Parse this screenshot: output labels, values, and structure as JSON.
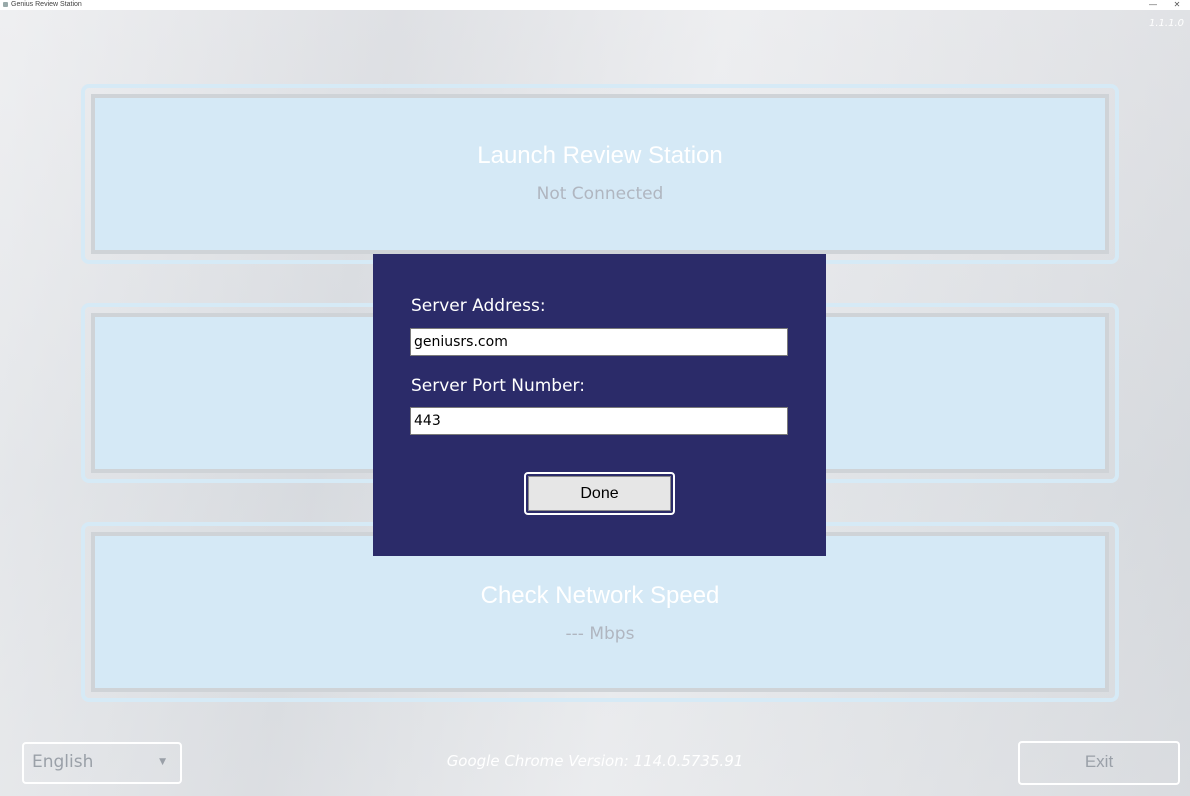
{
  "window": {
    "title": "Genius Review Station",
    "minimize_glyph": "—",
    "close_glyph": "✕"
  },
  "version": "1.1.1.0",
  "panels": [
    {
      "title": "Launch Review Station",
      "status": "Not Connected"
    },
    {
      "title": "",
      "status": ""
    },
    {
      "title": "Check Network Speed",
      "status": "--- Mbps"
    }
  ],
  "dialog": {
    "server_address_label": "Server Address:",
    "server_address_value": "geniusrs.com",
    "server_port_label": "Server Port Number:",
    "server_port_value": "443",
    "done_label": "Done"
  },
  "footer": {
    "language": "English",
    "chrome_version": "Google Chrome Version:  114.0.5735.91",
    "exit_label": "Exit"
  },
  "colors": {
    "dialog_bg": "#2b2b69",
    "panel_bg": "#d5e9f6",
    "panel_title": "#ffffff",
    "panel_status": "#b0b6c0"
  },
  "icons": {
    "app": "app-icon",
    "dropdown": "chevron-down-icon"
  }
}
